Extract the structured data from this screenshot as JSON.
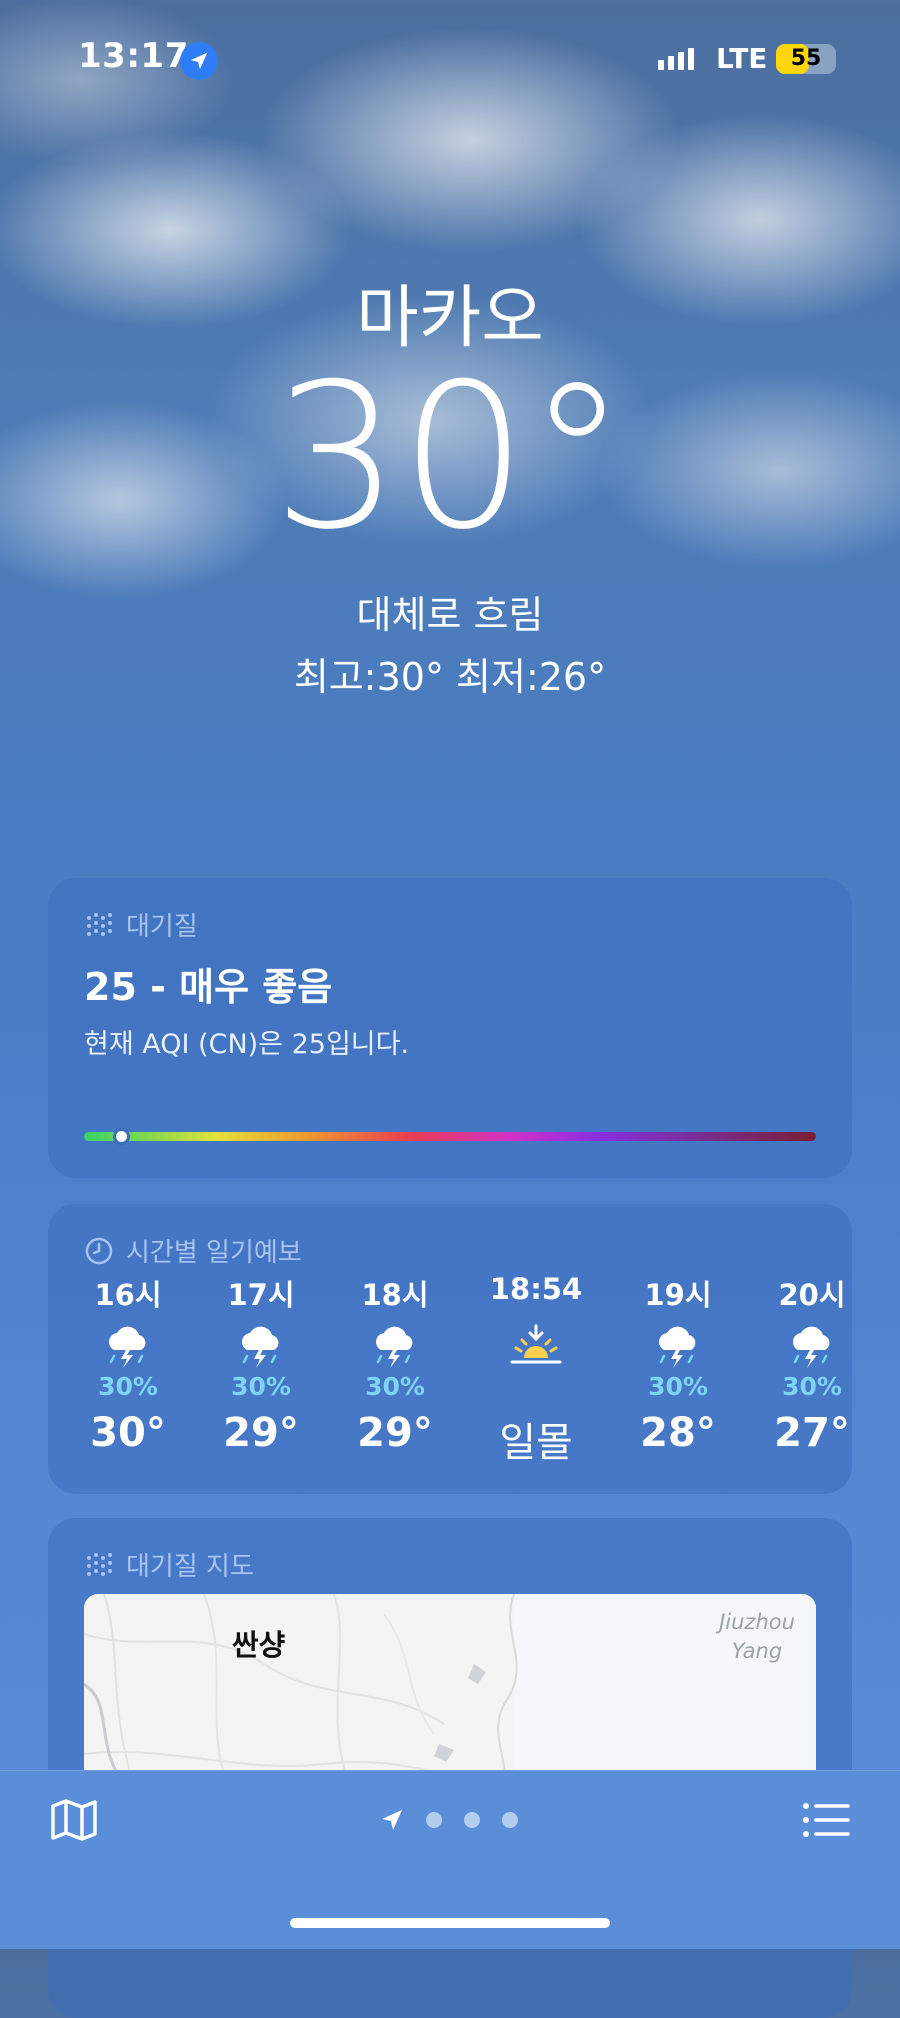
{
  "status_bar": {
    "time": "13:17",
    "network": "LTE",
    "battery_level": "55",
    "battery_fraction": 0.55
  },
  "weather": {
    "city": "마카오",
    "temperature": "30°",
    "condition": "대체로 흐림",
    "high_low": "최고:30°  최저:26°"
  },
  "air_quality": {
    "header": "대기질",
    "value": "25 - 매우 좋음",
    "description": "현재 AQI (CN)은 25입니다.",
    "scale_position_fraction": 0.05
  },
  "hourly": {
    "header": "시간별 일기예보",
    "items": [
      {
        "time": "16시",
        "icon": "thunderstorm-icon",
        "pop": "30%",
        "temp": "30°"
      },
      {
        "time": "17시",
        "icon": "thunderstorm-icon",
        "pop": "30%",
        "temp": "29°"
      },
      {
        "time": "18시",
        "icon": "thunderstorm-icon",
        "pop": "30%",
        "temp": "29°"
      },
      {
        "time": "18:54",
        "icon": "sunset-icon",
        "pop": "",
        "temp": "일몰"
      },
      {
        "time": "19시",
        "icon": "thunderstorm-icon",
        "pop": "30%",
        "temp": "28°"
      },
      {
        "time": "20시",
        "icon": "thunderstorm-icon",
        "pop": "30%",
        "temp": "27°"
      }
    ]
  },
  "air_quality_map": {
    "header": "대기질 지도",
    "place_label": "싼샹",
    "water_label_line1": "Jiuzhou",
    "water_label_line2": "Yang"
  },
  "toolbar": {
    "map_icon": "map-icon",
    "list_icon": "list-icon",
    "page_count": 3
  }
}
